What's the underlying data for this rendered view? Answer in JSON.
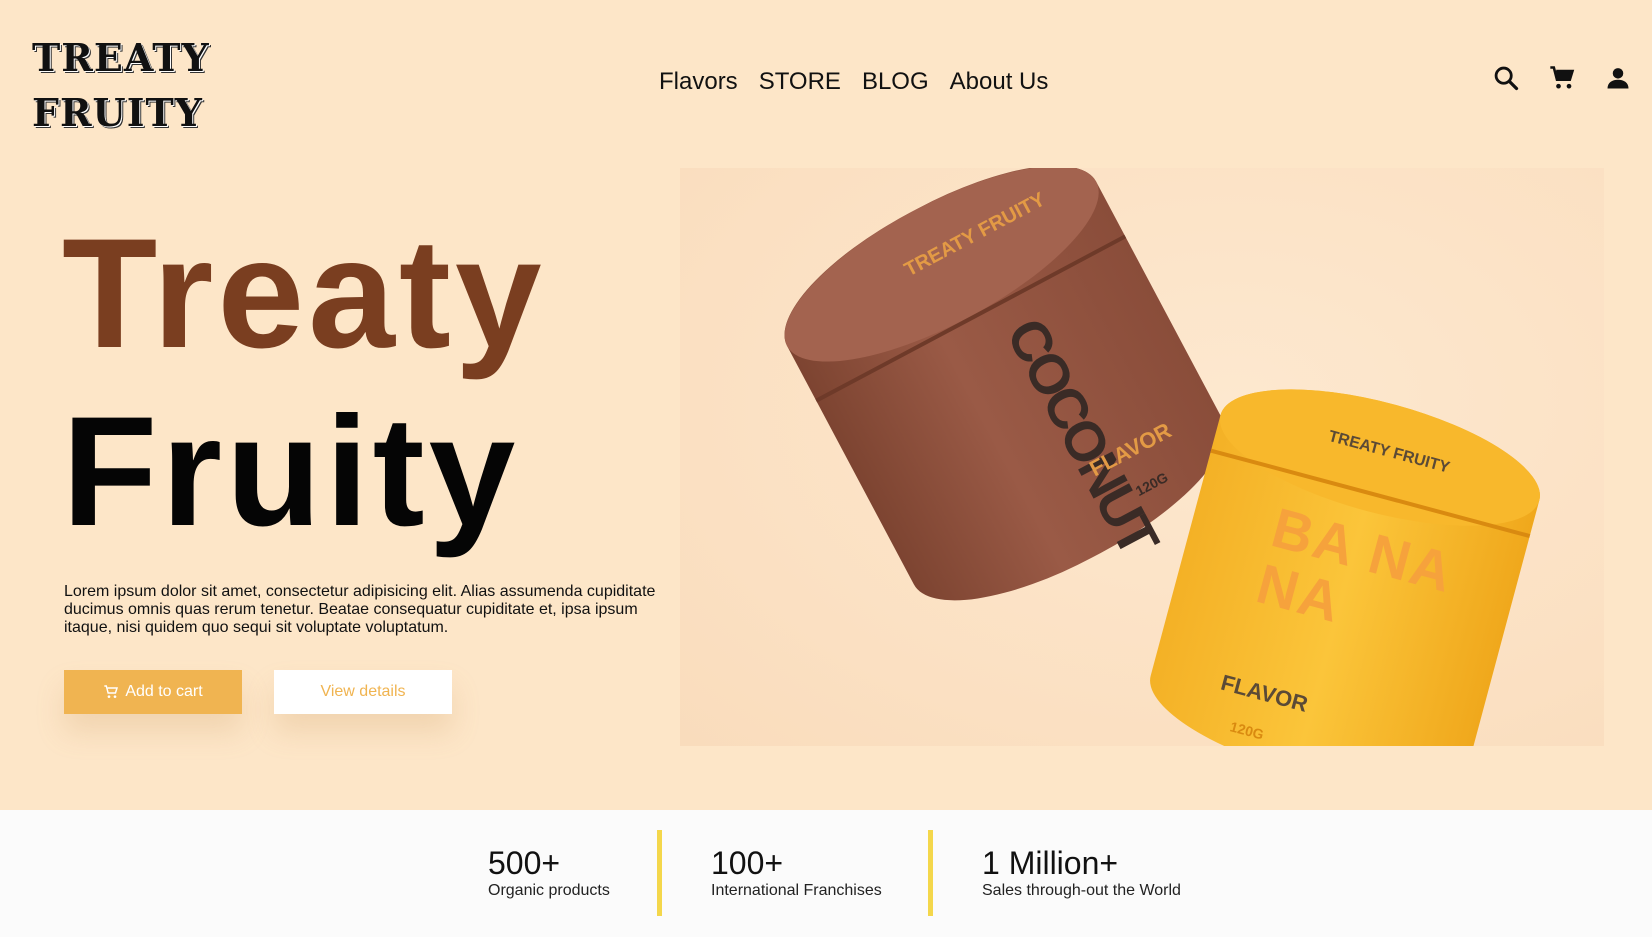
{
  "brand": {
    "line1": "TREATY",
    "line2": "FRUITY"
  },
  "nav": [
    "Flavors",
    "STORE",
    "BLOG",
    "About Us"
  ],
  "header_icons": [
    "search-icon",
    "cart-icon",
    "user-icon"
  ],
  "hero": {
    "title_line1": "Treaty",
    "title_line2": "Fruity",
    "description": "Lorem ipsum dolor sit amet, consectetur adipisicing elit. Alias assumenda cupiditate ducimus omnis quas rerum tenetur. Beatae consequatur cupiditate et, ipsa ipsum itaque, nisi quidem quo sequi sit voluptate voluptatum.",
    "add_to_cart": "Add to cart",
    "view_details": "View details"
  },
  "product_image": {
    "coconut": {
      "brand": "TREATY FRUITY",
      "word": "COCONUT",
      "flavor": "FLAVOR",
      "weight": "120G"
    },
    "banana": {
      "brand": "TREATY FRUITY",
      "word": "BA NA NA",
      "flavor": "FLAVOR",
      "weight": "120G"
    }
  },
  "stats": [
    {
      "value": "500+",
      "label": "Organic products"
    },
    {
      "value": "100+",
      "label": "International Franchises"
    },
    {
      "value": "1 Million+",
      "label": "Sales through-out the World"
    }
  ],
  "colors": {
    "background": "#fde6c8",
    "accent": "#f0b451",
    "brown": "#7a3e20",
    "divider": "#f4d74b"
  }
}
